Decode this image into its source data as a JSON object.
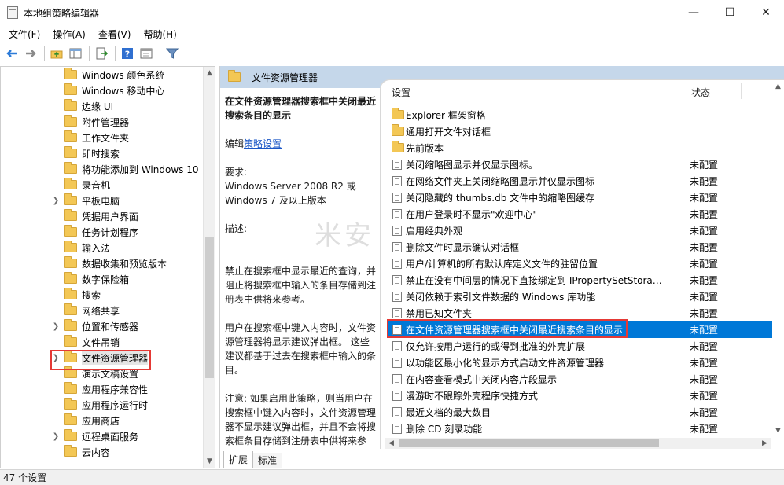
{
  "window": {
    "title": "本地组策略编辑器",
    "controls": {
      "minimize": "—",
      "maximize": "☐",
      "close": "✕"
    }
  },
  "menu": [
    "文件(F)",
    "操作(A)",
    "查看(V)",
    "帮助(H)"
  ],
  "toolbar": [
    "back-arrow-icon",
    "forward-arrow-icon",
    "folder-up-icon",
    "show-hide-tree-icon",
    "export-list-icon",
    "help-icon",
    "properties-pane-icon",
    "filter-icon"
  ],
  "tree": {
    "items": [
      {
        "label": "Windows 颜色系统",
        "expandable": false
      },
      {
        "label": "Windows 移动中心",
        "expandable": false
      },
      {
        "label": "边缘 UI",
        "expandable": false
      },
      {
        "label": "附件管理器",
        "expandable": false
      },
      {
        "label": "工作文件夹",
        "expandable": false
      },
      {
        "label": "即时搜索",
        "expandable": false
      },
      {
        "label": "将功能添加到 Windows 10",
        "expandable": false
      },
      {
        "label": "录音机",
        "expandable": false
      },
      {
        "label": "平板电脑",
        "expandable": true
      },
      {
        "label": "凭据用户界面",
        "expandable": false
      },
      {
        "label": "任务计划程序",
        "expandable": false
      },
      {
        "label": "输入法",
        "expandable": false
      },
      {
        "label": "数据收集和预览版本",
        "expandable": false
      },
      {
        "label": "数字保险箱",
        "expandable": false
      },
      {
        "label": "搜索",
        "expandable": false
      },
      {
        "label": "网络共享",
        "expandable": false
      },
      {
        "label": "位置和传感器",
        "expandable": true
      },
      {
        "label": "文件吊销",
        "expandable": false
      },
      {
        "label": "文件资源管理器",
        "expandable": true,
        "selected": true
      },
      {
        "label": "演示文稿设置",
        "expandable": false
      },
      {
        "label": "应用程序兼容性",
        "expandable": false
      },
      {
        "label": "应用程序运行时",
        "expandable": false
      },
      {
        "label": "应用商店",
        "expandable": false
      },
      {
        "label": "远程桌面服务",
        "expandable": true
      },
      {
        "label": "云内容",
        "expandable": false
      }
    ]
  },
  "right": {
    "header": "文件资源管理器",
    "description": {
      "title": "在文件资源管理器搜索框中关闭最近搜索条目的显示",
      "edit_prefix": "编辑",
      "edit_link": "策略设置",
      "req_label": "要求:",
      "req_text": "Windows Server 2008 R2 或 Windows 7 及以上版本",
      "desc_label": "描述:",
      "para1": "禁止在搜索框中显示最近的查询，并阻止将搜索框中输入的条目存储到注册表中供将来参考。",
      "para2": "用户在搜索框中键入内容时，文件资源管理器将显示建议弹出框。 这些建议都基于过去在搜索框中输入的条目。",
      "para3": "注意: 如果启用此策略，则当用户在搜索框中键入内容时，文件资源管理器不显示建议弹出框，并且不会将搜索框条目存储到注册表中供将来参考。 如果用户键入一个属性，则将显示与此属性匹配的值"
    },
    "columns": {
      "setting": "设置",
      "state": "状态"
    },
    "settings": [
      {
        "name": "Explorer 框架窗格",
        "state": "",
        "type": "folder"
      },
      {
        "name": "通用打开文件对话框",
        "state": "",
        "type": "folder"
      },
      {
        "name": "先前版本",
        "state": "",
        "type": "folder"
      },
      {
        "name": "关闭缩略图显示并仅显示图标。",
        "state": "未配置",
        "type": "policy"
      },
      {
        "name": "在网络文件夹上关闭缩略图显示并仅显示图标",
        "state": "未配置",
        "type": "policy"
      },
      {
        "name": "关闭隐藏的 thumbs.db 文件中的缩略图缓存",
        "state": "未配置",
        "type": "policy"
      },
      {
        "name": "在用户登录时不显示\"欢迎中心\"",
        "state": "未配置",
        "type": "policy"
      },
      {
        "name": "启用经典外观",
        "state": "未配置",
        "type": "policy"
      },
      {
        "name": "删除文件时显示确认对话框",
        "state": "未配置",
        "type": "policy"
      },
      {
        "name": "用户/计算机的所有默认库定义文件的驻留位置",
        "state": "未配置",
        "type": "policy"
      },
      {
        "name": "禁止在没有中间层的情况下直接绑定到 IPropertySetStora…",
        "state": "未配置",
        "type": "policy"
      },
      {
        "name": "关闭依赖于索引文件数据的 Windows 库功能",
        "state": "未配置",
        "type": "policy"
      },
      {
        "name": "禁用已知文件夹",
        "state": "未配置",
        "type": "policy"
      },
      {
        "name": "在文件资源管理器搜索框中关闭最近搜索条目的显示",
        "state": "未配置",
        "type": "policy",
        "selected": true
      },
      {
        "name": "仅允许按用户运行的或得到批准的外壳扩展",
        "state": "未配置",
        "type": "policy"
      },
      {
        "name": "以功能区最小化的显示方式启动文件资源管理器",
        "state": "未配置",
        "type": "policy"
      },
      {
        "name": "在内容查看模式中关闭内容片段显示",
        "state": "未配置",
        "type": "policy"
      },
      {
        "name": "漫游时不跟踪外壳程序快捷方式",
        "state": "未配置",
        "type": "policy"
      },
      {
        "name": "最近文档的最大数目",
        "state": "未配置",
        "type": "policy"
      },
      {
        "name": "删除 CD 刻录功能",
        "state": "未配置",
        "type": "policy"
      }
    ],
    "tabs": [
      "扩展",
      "标准"
    ],
    "active_tab": "扩展"
  },
  "watermark": "米安",
  "status": "47 个设置",
  "colors": {
    "selection": "#0078d7",
    "header_bg": "#c5d7ea",
    "highlight_box": "#e53935",
    "link": "#1a56c6"
  }
}
